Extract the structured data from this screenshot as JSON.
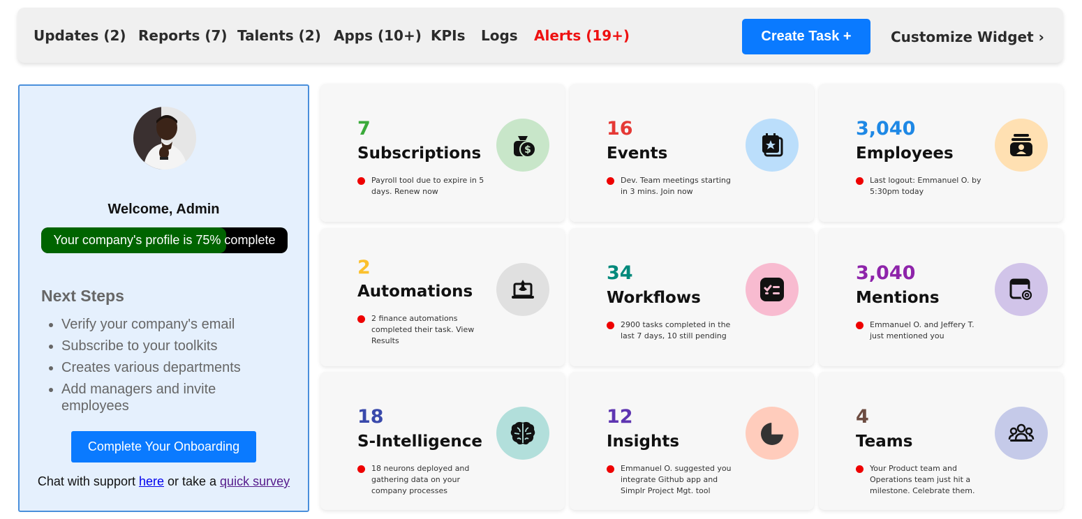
{
  "nav": {
    "items": [
      {
        "label": "Updates (2)"
      },
      {
        "label": "Reports (7)"
      },
      {
        "label": "Talents (2)"
      },
      {
        "label": "Apps (10+)"
      },
      {
        "label": "KPIs"
      },
      {
        "label": "Logs"
      },
      {
        "label": "Alerts (19+)"
      }
    ],
    "create_task": "Create Task +",
    "customize_widget": "Customize Widget ›",
    "alert_color": "#ee1111",
    "accent": "#0a7aff"
  },
  "welcome": {
    "title": "Welcome, Admin",
    "progress_text": "Your company's profile is 75% complete",
    "progress_value": 0.75,
    "next_steps_title": "Next Steps",
    "steps": [
      "Verify your company's email",
      "Subscribe to your toolkits",
      "Creates various departments",
      "Add managers and invite employees"
    ],
    "onboarding_button": "Complete Your Onboarding",
    "support_prefix": "Chat with support ",
    "support_link": "here",
    "support_middle": " or take a ",
    "survey_link": "quick survey"
  },
  "cards": [
    {
      "count": "7",
      "title": "Subscriptions",
      "note": "Payroll tool due to expire in 5 days. Renew now",
      "color": "#3aaa3a",
      "icon_bg": "#c8e6c9",
      "icon": "money-bag-icon"
    },
    {
      "count": "16",
      "title": "Events",
      "note": "Dev. Team meetings starting in 3 mins. Join now",
      "color": "#e53935",
      "icon_bg": "#bbdefb",
      "icon": "calendar-star-icon"
    },
    {
      "count": "3,040",
      "title": "Employees",
      "note": "Last logout: Emmanuel O. by 5:30pm today",
      "color": "#1e88e5",
      "icon_bg": "#ffe0b2",
      "icon": "id-badge-icon"
    },
    {
      "count": "2",
      "title": "Automations",
      "note": "2 finance automations completed their task. View Results",
      "color": "#fbc02d",
      "icon_bg": "#e0e0e0",
      "icon": "laptop-launch-icon"
    },
    {
      "count": "34",
      "title": "Workflows",
      "note": "2900 tasks completed in the last 7 days, 10 still pending",
      "color": "#00897b",
      "icon_bg": "#f8bbd0",
      "icon": "checklist-icon"
    },
    {
      "count": "3,040",
      "title": "Mentions",
      "note": "Emmanuel O. and Jeffery T. just mentioned you",
      "color": "#8e24aa",
      "icon_bg": "#d1c4e9",
      "icon": "mention-icon"
    },
    {
      "count": "18",
      "title": "S-Intelligence",
      "note": "18 neurons deployed and gathering data on your company processes",
      "color": "#3949ab",
      "icon_bg": "#b2dfdb",
      "icon": "brain-icon"
    },
    {
      "count": "12",
      "title": "Insights",
      "note": "Emmanuel O. suggested you integrate Github app and Simplr Project Mgt. tool",
      "color": "#5e35b1",
      "icon_bg": "#ffccbc",
      "icon": "pie-chart-icon"
    },
    {
      "count": "4",
      "title": "Teams",
      "note": "Your Product team and Operations team just hit a milestone. Celebrate them.",
      "color": "#6d4c41",
      "icon_bg": "#c5cae9",
      "icon": "team-icon"
    }
  ]
}
